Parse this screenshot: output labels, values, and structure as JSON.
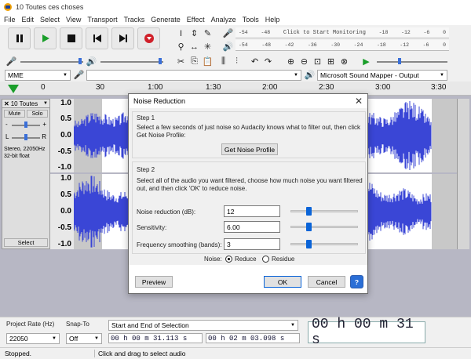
{
  "window": {
    "title": "10 Toutes ces choses"
  },
  "menu": [
    "File",
    "Edit",
    "Select",
    "View",
    "Transport",
    "Tracks",
    "Generate",
    "Effect",
    "Analyze",
    "Tools",
    "Help"
  ],
  "meter": {
    "record_ticks": [
      "-54",
      "-48",
      "Click to Start Monitoring",
      "-18",
      "-12",
      "-6",
      "0"
    ],
    "play_ticks": [
      "-54",
      "-48",
      "-42",
      "-36",
      "-30",
      "-24",
      "-18",
      "-12",
      "-6",
      "0"
    ]
  },
  "devices": {
    "host": "MME",
    "output": "Microsoft Sound Mapper - Output"
  },
  "ruler": {
    "ticks": [
      "0",
      "30",
      "1:00",
      "1:30",
      "2:00",
      "2:30",
      "3:00",
      "3:30"
    ]
  },
  "track": {
    "name": "10 Toutes",
    "mute": "Mute",
    "solo": "Solo",
    "gain_left": "-",
    "gain_right": "+",
    "pan_left": "L",
    "pan_right": "R",
    "info": "Stereo, 22050Hz\n32-bit float",
    "select": "Select",
    "scale_top": [
      "1.0",
      "0.5",
      "0.0",
      "-0.5",
      "-1.0"
    ],
    "scale_bottom": [
      "1.0",
      "0.5",
      "0.0",
      "-0.5",
      "-1.0"
    ]
  },
  "dialog": {
    "title": "Noise Reduction",
    "step1": "Step 1",
    "step1_text": "Select a few seconds of just noise so Audacity knows what to filter out, then click Get Noise Profile:",
    "get_profile": "Get Noise Profile",
    "step2": "Step 2",
    "step2_text": "Select all of the audio you want filtered, choose how much noise you want filtered out, and then click 'OK' to reduce noise.",
    "noise_reduction_label": "Noise reduction (dB):",
    "noise_reduction_value": "12",
    "sensitivity_label": "Sensitivity:",
    "sensitivity_value": "6.00",
    "smoothing_label": "Frequency smoothing (bands):",
    "smoothing_value": "3",
    "noise_label": "Noise:",
    "reduce": "Reduce",
    "residue": "Residue",
    "preview": "Preview",
    "ok": "OK",
    "cancel": "Cancel",
    "help": "?"
  },
  "selection": {
    "project_rate_label": "Project Rate (Hz)",
    "project_rate": "22050",
    "snap_label": "Snap-To",
    "snap": "Off",
    "mode": "Start and End of Selection",
    "start": "00 h 00 m 31.113 s",
    "end": "00 h 02 m 03.098 s",
    "big_time": "00 h 00 m 31 s"
  },
  "status": {
    "left": "Stopped.",
    "right": "Click and drag to select audio"
  },
  "colors": {
    "wave": "#3a46d6",
    "selected_bg": "#ffffff",
    "unselected_bg": "#c8c8c8",
    "accent": "#3a6fd8"
  }
}
